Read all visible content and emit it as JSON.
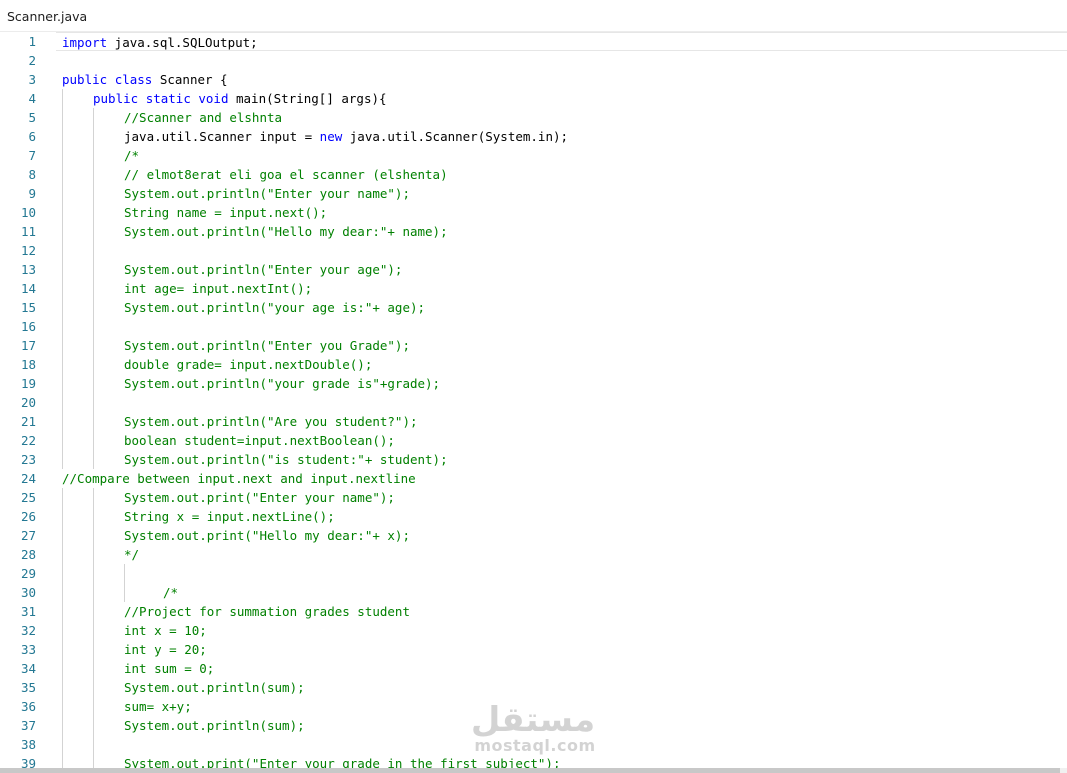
{
  "tab": {
    "title": "Scanner.java"
  },
  "editor": {
    "current_line": 1,
    "lines": [
      {
        "n": "1",
        "indent": 0,
        "tokens": [
          {
            "t": "kw",
            "v": "import"
          },
          {
            "t": "text",
            "v": " java.sql.SQLOutput;"
          }
        ]
      },
      {
        "n": "2",
        "indent": 0,
        "tokens": []
      },
      {
        "n": "3",
        "indent": 0,
        "tokens": [
          {
            "t": "kw",
            "v": "public"
          },
          {
            "t": "text",
            "v": " "
          },
          {
            "t": "kw",
            "v": "class"
          },
          {
            "t": "text",
            "v": " Scanner {"
          }
        ]
      },
      {
        "n": "4",
        "indent": 1,
        "tokens": [
          {
            "t": "kw",
            "v": "public"
          },
          {
            "t": "text",
            "v": " "
          },
          {
            "t": "kw",
            "v": "static"
          },
          {
            "t": "text",
            "v": " "
          },
          {
            "t": "kw",
            "v": "void"
          },
          {
            "t": "text",
            "v": " main(String[] args){"
          }
        ]
      },
      {
        "n": "5",
        "indent": 2,
        "tokens": [
          {
            "t": "comment",
            "v": "//Scanner and elshnta"
          }
        ]
      },
      {
        "n": "6",
        "indent": 2,
        "tokens": [
          {
            "t": "text",
            "v": "java.util.Scanner input = "
          },
          {
            "t": "kw",
            "v": "new"
          },
          {
            "t": "text",
            "v": " java.util.Scanner(System.in);"
          }
        ]
      },
      {
        "n": "7",
        "indent": 2,
        "tokens": [
          {
            "t": "comment",
            "v": "/*"
          }
        ]
      },
      {
        "n": "8",
        "indent": 2,
        "tokens": [
          {
            "t": "comment",
            "v": "// elmot8erat eli goa el scanner (elshenta)"
          }
        ]
      },
      {
        "n": "9",
        "indent": 2,
        "tokens": [
          {
            "t": "comment",
            "v": "System.out.println(\"Enter your name\");"
          }
        ]
      },
      {
        "n": "10",
        "indent": 2,
        "tokens": [
          {
            "t": "comment",
            "v": "String name = input.next();"
          }
        ]
      },
      {
        "n": "11",
        "indent": 2,
        "tokens": [
          {
            "t": "comment",
            "v": "System.out.println(\"Hello my dear:\"+ name);"
          }
        ]
      },
      {
        "n": "12",
        "indent": 2,
        "tokens": []
      },
      {
        "n": "13",
        "indent": 2,
        "tokens": [
          {
            "t": "comment",
            "v": "System.out.println(\"Enter your age\");"
          }
        ]
      },
      {
        "n": "14",
        "indent": 2,
        "tokens": [
          {
            "t": "comment",
            "v": "int age= input.nextInt();"
          }
        ]
      },
      {
        "n": "15",
        "indent": 2,
        "tokens": [
          {
            "t": "comment",
            "v": "System.out.println(\"your age is:\"+ age);"
          }
        ]
      },
      {
        "n": "16",
        "indent": 2,
        "tokens": []
      },
      {
        "n": "17",
        "indent": 2,
        "tokens": [
          {
            "t": "comment",
            "v": "System.out.println(\"Enter you Grade\");"
          }
        ]
      },
      {
        "n": "18",
        "indent": 2,
        "tokens": [
          {
            "t": "comment",
            "v": "double grade= input.nextDouble();"
          }
        ]
      },
      {
        "n": "19",
        "indent": 2,
        "tokens": [
          {
            "t": "comment",
            "v": "System.out.println(\"your grade is\"+grade);"
          }
        ]
      },
      {
        "n": "20",
        "indent": 2,
        "tokens": []
      },
      {
        "n": "21",
        "indent": 2,
        "tokens": [
          {
            "t": "comment",
            "v": "System.out.println(\"Are you student?\");"
          }
        ]
      },
      {
        "n": "22",
        "indent": 2,
        "tokens": [
          {
            "t": "comment",
            "v": "boolean student=input.nextBoolean();"
          }
        ]
      },
      {
        "n": "23",
        "indent": 2,
        "tokens": [
          {
            "t": "comment",
            "v": "System.out.println(\"is student:\"+ student);"
          }
        ]
      },
      {
        "n": "24",
        "indent": 0,
        "tokens": [
          {
            "t": "comment",
            "v": "//Compare between input.next and input.nextline"
          }
        ]
      },
      {
        "n": "25",
        "indent": 2,
        "tokens": [
          {
            "t": "comment",
            "v": "System.out.print(\"Enter your name\");"
          }
        ]
      },
      {
        "n": "26",
        "indent": 2,
        "tokens": [
          {
            "t": "comment",
            "v": "String x = input.nextLine();"
          }
        ]
      },
      {
        "n": "27",
        "indent": 2,
        "tokens": [
          {
            "t": "comment",
            "v": "System.out.print(\"Hello my dear:\"+ x);"
          }
        ]
      },
      {
        "n": "28",
        "indent": 2,
        "tokens": [
          {
            "t": "comment",
            "v": "*/"
          }
        ]
      },
      {
        "n": "29",
        "indent": 3,
        "tokens": []
      },
      {
        "n": "30",
        "indent": 3,
        "tokens": [
          {
            "t": "comment",
            "v": "/*"
          }
        ]
      },
      {
        "n": "31",
        "indent": 2,
        "tokens": [
          {
            "t": "comment",
            "v": "//Project for summation grades student"
          }
        ]
      },
      {
        "n": "32",
        "indent": 2,
        "tokens": [
          {
            "t": "comment",
            "v": "int x = 10;"
          }
        ]
      },
      {
        "n": "33",
        "indent": 2,
        "tokens": [
          {
            "t": "comment",
            "v": "int y = 20;"
          }
        ]
      },
      {
        "n": "34",
        "indent": 2,
        "tokens": [
          {
            "t": "comment",
            "v": "int sum = 0;"
          }
        ]
      },
      {
        "n": "35",
        "indent": 2,
        "tokens": [
          {
            "t": "comment",
            "v": "System.out.println(sum);"
          }
        ]
      },
      {
        "n": "36",
        "indent": 2,
        "tokens": [
          {
            "t": "comment",
            "v": "sum= x+y;"
          }
        ]
      },
      {
        "n": "37",
        "indent": 2,
        "tokens": [
          {
            "t": "comment",
            "v": "System.out.println(sum);"
          }
        ]
      },
      {
        "n": "38",
        "indent": 2,
        "tokens": []
      },
      {
        "n": "39",
        "indent": 2,
        "tokens": [
          {
            "t": "comment",
            "v": "System.out.print(\"Enter your grade in the first subject\");"
          }
        ]
      }
    ]
  },
  "colors": {
    "keyword": "#0000ff",
    "text": "#000000",
    "comment": "#008000",
    "line_number": "#237893"
  },
  "watermark": {
    "brand": "mostaql.com",
    "logo_text": "مستقل"
  }
}
